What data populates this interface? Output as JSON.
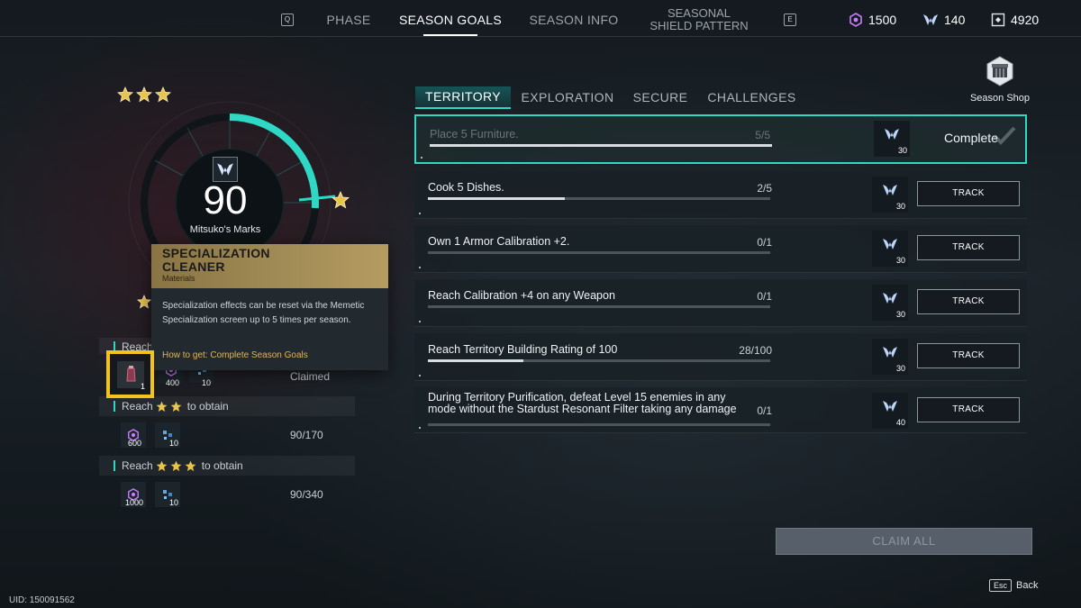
{
  "topbar": {
    "prev_key": "Q",
    "next_key": "E",
    "tabs": [
      "PHASE",
      "SEASON GOALS",
      "SEASON INFO"
    ],
    "tab_pattern_line1": "SEASONAL",
    "tab_pattern_line2": "SHIELD PATTERN",
    "active_tab": "SEASON GOALS",
    "currencies": [
      {
        "icon": "purple-gem-icon",
        "value": "1500",
        "color": "#c77bff"
      },
      {
        "icon": "mitsuko-mark-icon",
        "value": "140",
        "color": "#bcd6ff"
      },
      {
        "icon": "shield-token-icon",
        "value": "4920",
        "color": "#dfe6ea"
      }
    ]
  },
  "marks": {
    "value": "90",
    "label": "Mitsuko's Marks",
    "progress_fraction": 0.26
  },
  "rewards": [
    {
      "reach": "Reach",
      "stars": 1,
      "obtain": "",
      "status": "Claimed",
      "items": [
        {
          "icon": "purple-gem-icon",
          "qty": "400"
        },
        {
          "icon": "material-icon",
          "qty": "10"
        }
      ]
    },
    {
      "reach": "Reach",
      "stars": 2,
      "obtain": "to obtain",
      "status": "90/170",
      "items": [
        {
          "icon": "purple-gem-icon",
          "qty": "600"
        },
        {
          "icon": "material-icon",
          "qty": "10"
        }
      ]
    },
    {
      "reach": "Reach",
      "stars": 3,
      "obtain": "to obtain",
      "status": "90/340",
      "items": [
        {
          "icon": "purple-gem-icon",
          "qty": "1000"
        },
        {
          "icon": "material-icon",
          "qty": "10"
        }
      ]
    }
  ],
  "tooltip": {
    "title": "SPECIALIZATION CLEANER",
    "type": "Materials",
    "description": "Specialization effects can be reset via the Memetic Specialization screen up to 5 times per season.",
    "how_to_get": "How to get: Complete Season Goals",
    "item_qty": "1"
  },
  "categories": [
    "TERRITORY",
    "EXPLORATION",
    "SECURE",
    "CHALLENGES"
  ],
  "active_category": "TERRITORY",
  "goals": [
    {
      "text": "Place 5 Furniture.",
      "count": "5/5",
      "progress": 1.0,
      "reward": "30",
      "state": "complete",
      "status_label": "Complete"
    },
    {
      "text": "Cook 5 Dishes.",
      "count": "2/5",
      "progress": 0.4,
      "reward": "30",
      "state": "track",
      "status_label": "TRACK"
    },
    {
      "text": "Own 1 Armor Calibration +2.",
      "count": "0/1",
      "progress": 0.0,
      "reward": "30",
      "state": "track",
      "status_label": "TRACK"
    },
    {
      "text": "Reach Calibration +4 on any Weapon",
      "count": "0/1",
      "progress": 0.0,
      "reward": "30",
      "state": "track",
      "status_label": "TRACK"
    },
    {
      "text": "Reach Territory Building Rating of 100",
      "count": "28/100",
      "progress": 0.28,
      "reward": "30",
      "state": "track",
      "status_label": "TRACK"
    },
    {
      "text": "During Territory Purification, defeat Level 15 enemies in any mode without the Stardust Resonant Filter taking any damage",
      "count": "0/1",
      "progress": 0.0,
      "reward": "40",
      "state": "track",
      "status_label": "TRACK"
    }
  ],
  "claim_all": "CLAIM ALL",
  "season_shop": "Season Shop",
  "uid": "UID: 150091562",
  "back": {
    "key": "Esc",
    "label": "Back"
  },
  "colors": {
    "accent": "#2ed8c4",
    "star": "#e8c44a",
    "tooltip_gold": "#a38d57",
    "highlight": "#f2c21d"
  }
}
